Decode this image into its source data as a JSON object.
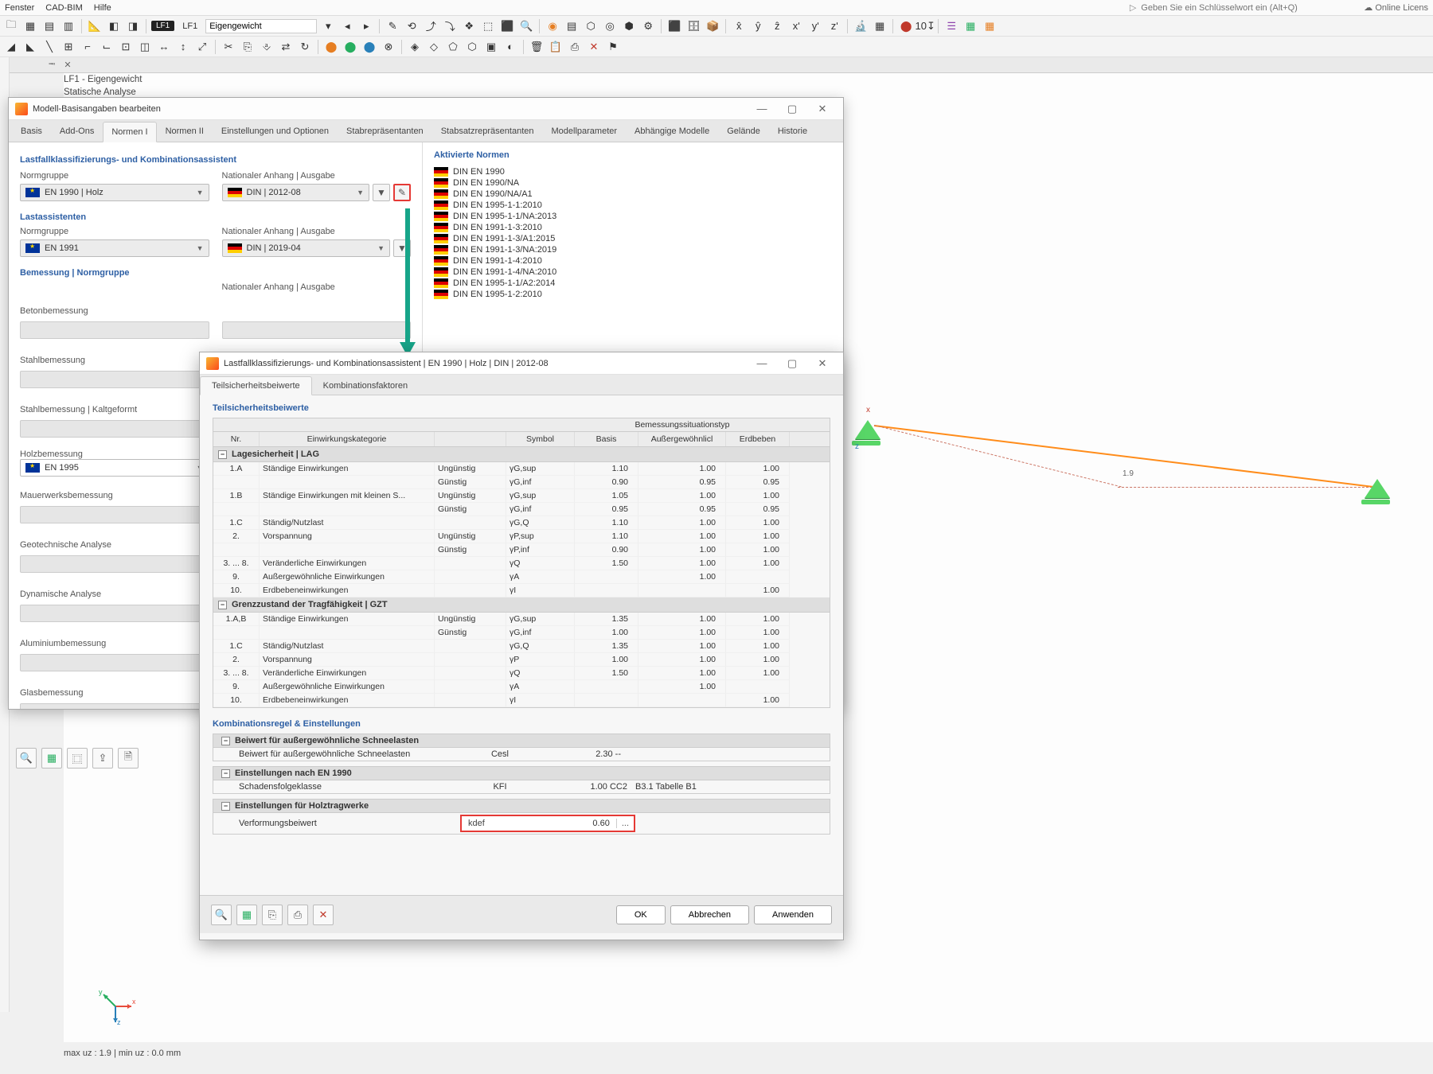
{
  "topmenu": {
    "fenster": "Fenster",
    "cadbim": "CAD-BIM",
    "hilfe": "Hilfe",
    "keyword_ph": "Geben Sie ein Schlüsselwort ein (Alt+Q)",
    "online": "Online Licens"
  },
  "lfbar": {
    "chip": "LF1",
    "name": "LF1",
    "desc": "Eigengewicht"
  },
  "doc": {
    "lf_line1": "LF1 - Eigengewicht",
    "lf_line2": "Statische Analyse"
  },
  "dlg1": {
    "title": "Modell-Basisangaben bearbeiten",
    "tabs": [
      "Basis",
      "Add-Ons",
      "Normen I",
      "Normen II",
      "Einstellungen und Optionen",
      "Stabrepräsentanten",
      "Stabsatzrepräsentanten",
      "Modellparameter",
      "Abhängige Modelle",
      "Gelände",
      "Historie"
    ],
    "sec_klass": "Lastfallklassifizierungs- und Kombinationsassistent",
    "label_normgruppe": "Normgruppe",
    "label_anhang": "Nationaler Anhang | Ausgabe",
    "combo_en1990": "EN 1990 | Holz",
    "combo_din2012": "DIN | 2012-08",
    "sec_lastass": "Lastassistenten",
    "combo_en1991": "EN 1991",
    "combo_din2019": "DIN | 2019-04",
    "sec_bemessung": "Bemessung | Normgruppe",
    "bem_items": [
      "Betonbemessung",
      "Stahlbemessung",
      "Stahlbemessung | Kaltgeformt"
    ],
    "holz_head": "Holzbemessung",
    "combo_en1995": "EN 1995",
    "bem_items2": [
      "Mauerwerksbemessung",
      "Geotechnische Analyse",
      "Dynamische Analyse",
      "Aluminiumbemessung",
      "Glasbemessung"
    ],
    "aktiv": "Aktivierte Normen",
    "norms": [
      "DIN EN 1990",
      "DIN EN 1990/NA",
      "DIN EN 1990/NA/A1",
      "DIN EN 1995-1-1:2010",
      "DIN EN 1995-1-1/NA:2013",
      "DIN EN 1991-1-3:2010",
      "DIN EN 1991-1-3/A1:2015",
      "DIN EN 1991-1-3/NA:2019",
      "DIN EN 1991-1-4:2010",
      "DIN EN 1991-1-4/NA:2010",
      "DIN EN 1995-1-1/A2:2014",
      "DIN EN 1995-1-2:2010"
    ]
  },
  "dlg2": {
    "title": "Lastfallklassifizierungs- und Kombinationsassistent | EN 1990 | Holz | DIN | 2012-08",
    "tab1": "Teilsicherheitsbeiwerte",
    "tab2": "Kombinationsfaktoren",
    "head_psf": "Teilsicherheitsbeiwerte",
    "col_nr": "Nr.",
    "col_kat": "Einwirkungskategorie",
    "col_sym": "Symbol",
    "col_basis": "Basis",
    "col_bsit": "Bemessungssituationstyp",
    "col_aus": "Außergewöhnlicl",
    "col_erd": "Erdbeben",
    "group_lag": "Lagesicherheit | LAG",
    "group_gzt": "Grenzzustand der Tragfähigkeit | GZT",
    "rows_lag": [
      {
        "nr": "1.A",
        "kat": "Ständige Einwirkungen",
        "gu": "Ungünstig",
        "sym": "γG,sup",
        "b": "1.10",
        "a": "1.00",
        "e": "1.00"
      },
      {
        "nr": "",
        "kat": "",
        "gu": "Günstig",
        "sym": "γG,inf",
        "b": "0.90",
        "a": "0.95",
        "e": "0.95"
      },
      {
        "nr": "1.B",
        "kat": "Ständige Einwirkungen mit kleinen S...",
        "gu": "Ungünstig",
        "sym": "γG,sup",
        "b": "1.05",
        "a": "1.00",
        "e": "1.00"
      },
      {
        "nr": "",
        "kat": "",
        "gu": "Günstig",
        "sym": "γG,inf",
        "b": "0.95",
        "a": "0.95",
        "e": "0.95"
      },
      {
        "nr": "1.C",
        "kat": "Ständig/Nutzlast",
        "gu": "",
        "sym": "γG,Q",
        "b": "1.10",
        "a": "1.00",
        "e": "1.00"
      },
      {
        "nr": "2.",
        "kat": "Vorspannung",
        "gu": "Ungünstig",
        "sym": "γP,sup",
        "b": "1.10",
        "a": "1.00",
        "e": "1.00"
      },
      {
        "nr": "",
        "kat": "",
        "gu": "Günstig",
        "sym": "γP,inf",
        "b": "0.90",
        "a": "1.00",
        "e": "1.00"
      },
      {
        "nr": "3. ... 8.",
        "kat": "Veränderliche Einwirkungen",
        "gu": "",
        "sym": "γQ",
        "b": "1.50",
        "a": "1.00",
        "e": "1.00"
      },
      {
        "nr": "9.",
        "kat": "Außergewöhnliche Einwirkungen",
        "gu": "",
        "sym": "γA",
        "b": "",
        "a": "1.00",
        "e": ""
      },
      {
        "nr": "10.",
        "kat": "Erdbebeneinwirkungen",
        "gu": "",
        "sym": "γI",
        "b": "",
        "a": "",
        "e": "1.00"
      }
    ],
    "rows_gzt": [
      {
        "nr": "1.A,B",
        "kat": "Ständige Einwirkungen",
        "gu": "Ungünstig",
        "sym": "γG,sup",
        "b": "1.35",
        "a": "1.00",
        "e": "1.00"
      },
      {
        "nr": "",
        "kat": "",
        "gu": "Günstig",
        "sym": "γG,inf",
        "b": "1.00",
        "a": "1.00",
        "e": "1.00"
      },
      {
        "nr": "1.C",
        "kat": "Ständig/Nutzlast",
        "gu": "",
        "sym": "γG,Q",
        "b": "1.35",
        "a": "1.00",
        "e": "1.00"
      },
      {
        "nr": "2.",
        "kat": "Vorspannung",
        "gu": "",
        "sym": "γP",
        "b": "1.00",
        "a": "1.00",
        "e": "1.00"
      },
      {
        "nr": "3. ... 8.",
        "kat": "Veränderliche Einwirkungen",
        "gu": "",
        "sym": "γQ",
        "b": "1.50",
        "a": "1.00",
        "e": "1.00"
      },
      {
        "nr": "9.",
        "kat": "Außergewöhnliche Einwirkungen",
        "gu": "",
        "sym": "γA",
        "b": "",
        "a": "1.00",
        "e": ""
      },
      {
        "nr": "10.",
        "kat": "Erdbebeneinwirkungen",
        "gu": "",
        "sym": "γI",
        "b": "",
        "a": "",
        "e": "1.00"
      }
    ],
    "kombi_head": "Kombinationsregel & Einstellungen",
    "snow_hdr": "Beiwert für außergewöhnliche Schneelasten",
    "snow_row": "Beiwert für außergewöhnliche Schneelasten",
    "snow_sym": "Cesl",
    "snow_val": "2.30",
    "snow_dash": "--",
    "en1990_hdr": "Einstellungen nach EN 1990",
    "schad": "Schadensfolgeklasse",
    "schad_sym": "KFI",
    "schad_val": "1.00",
    "schad_cc": "CC2",
    "schad_ref": "B3.1 Tabelle B1",
    "holz_hdr": "Einstellungen für Holztragwerke",
    "verf": "Verformungsbeiwert",
    "kdef_sym": "kdef",
    "kdef_val": "0.60",
    "kdef_dots": "...",
    "btn_ok": "OK",
    "btn_cancel": "Abbrechen",
    "btn_apply": "Anwenden"
  },
  "status": {
    "text": "max uz : 1.9 | min uz : 0.0 mm"
  },
  "model": {
    "dim": "1.9"
  }
}
